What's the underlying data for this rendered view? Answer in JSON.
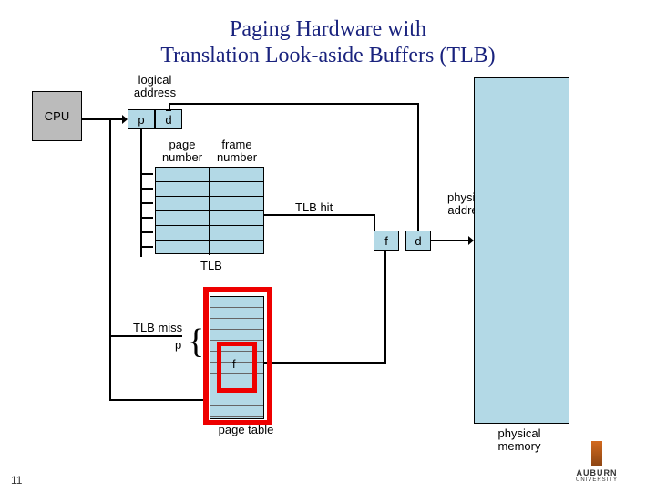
{
  "title_line1": "Paging Hardware with",
  "title_line2": "Translation Look-aside Buffers (TLB)",
  "labels": {
    "cpu": "CPU",
    "logical_address": "logical address",
    "p": "p",
    "d": "d",
    "page_number": "page number",
    "frame_number": "frame number",
    "tlb": "TLB",
    "tlb_hit": "TLB hit",
    "tlb_miss": "TLB miss",
    "f": "f",
    "physical_address": "physical address",
    "physical_memory": "physical memory",
    "page_table": "page table",
    "p_brace": "p"
  },
  "page_number": "11",
  "branding": {
    "university": "AUBURN",
    "sub": "UNIVERSITY"
  },
  "chart_data": {
    "type": "diagram",
    "description": "Paging hardware with TLB: CPU emits logical address (p|d). p is looked up in TLB (page→frame). On TLB hit, frame f combined with d forms physical address into physical memory. On TLB miss, p indexes page table to obtain f, which is loaded into TLB and used with d for physical address.",
    "components": [
      "CPU",
      "logical address (p,d)",
      "TLB",
      "page table",
      "physical address (f,d)",
      "physical memory"
    ],
    "flows": [
      {
        "from": "CPU",
        "to": "logical address",
        "label": ""
      },
      {
        "from": "logical address.p",
        "to": "TLB",
        "label": ""
      },
      {
        "from": "TLB",
        "to": "physical address.f",
        "label": "TLB hit"
      },
      {
        "from": "logical address.p",
        "to": "page table",
        "label": "TLB miss"
      },
      {
        "from": "page table",
        "to": "physical address.f",
        "label": ""
      },
      {
        "from": "logical address.d",
        "to": "physical address.d",
        "label": ""
      },
      {
        "from": "physical address",
        "to": "physical memory",
        "label": ""
      }
    ],
    "tlb_rows": 6,
    "tlb_columns": [
      "page number",
      "frame number"
    ]
  }
}
